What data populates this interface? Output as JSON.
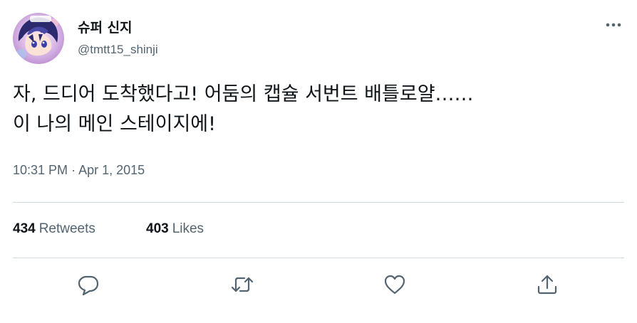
{
  "tweet": {
    "author": {
      "display_name": "슈퍼 신지",
      "handle": "@tmtt15_shinji",
      "avatar_badge": "itta"
    },
    "text_line1": "자, 드디어 도착했다고! 어둠의 캡슐 서번트 배틀로얄……",
    "text_line2": "이 나의 메인 스테이지에!",
    "time": "10:31 PM",
    "separator": "·",
    "date": "Apr 1, 2015",
    "retweets": {
      "count": "434",
      "label": "Retweets"
    },
    "likes": {
      "count": "403",
      "label": "Likes"
    }
  },
  "icons": {
    "more": "more-horizontal-icon",
    "reply": "reply-bubble-icon",
    "retweet": "retweet-arrows-icon",
    "like": "heart-icon",
    "share": "share-upload-icon"
  },
  "colors": {
    "text": "#0f1419",
    "secondary": "#536471",
    "divider": "#cfd9de",
    "background": "#ffffff"
  }
}
